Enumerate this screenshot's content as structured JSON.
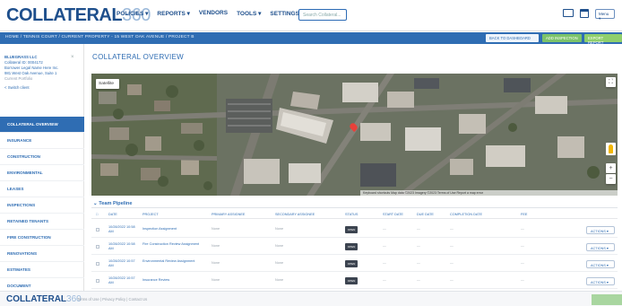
{
  "app": {
    "logo_bold": "COLLATERAL",
    "logo_light": "360"
  },
  "nav": [
    {
      "label": "POLICIES ▾"
    },
    {
      "label": "REPORTS ▾"
    },
    {
      "label": "VENDORS"
    },
    {
      "label": "TOOLS ▾"
    },
    {
      "label": "SETTINGS ▾"
    }
  ],
  "search": {
    "placeholder": "Search Collateral..."
  },
  "user": {
    "label": "Menu ▾"
  },
  "breadcrumb": "HOME / TENNIS COURT / CURRENT PROPERTY - 15 WEST OAK AVENUE / PROJECT B",
  "crumb_buttons": {
    "back": "BACK TO DASHBOARD",
    "add": "ADD INSPECTION",
    "export": "EXPORT REPORT"
  },
  "client": {
    "name": "BLUEGRASS LLC",
    "id": "Collateral ID: 0004172",
    "line1": "Borrower Legal Name Here Inc.",
    "line2": "981 West Oak Avenue, Suite 1",
    "status": "Current Portfolio",
    "action": "< Switch client",
    "close": "×"
  },
  "sidebar": {
    "items": [
      {
        "label": "COLLATERAL OVERVIEW",
        "active": true
      },
      {
        "label": "INSURANCE",
        "active": false
      },
      {
        "label": "CONSTRUCTION",
        "active": false
      },
      {
        "label": "ENVIRONMENTAL",
        "active": false
      },
      {
        "label": "LEASES",
        "active": false
      },
      {
        "label": "INSPECTIONS",
        "active": false
      },
      {
        "label": "RETAINED TENANTS",
        "active": false
      },
      {
        "label": "FIRE CONSTRUCTION",
        "active": false
      },
      {
        "label": "RENOVATIONS",
        "active": false
      },
      {
        "label": "ESTIMATES",
        "active": false
      },
      {
        "label": "DOCUMENT",
        "active": false
      }
    ]
  },
  "page": {
    "title": "COLLATERAL OVERVIEW"
  },
  "map": {
    "view_button": "Satellite",
    "footer": "Keyboard shortcuts  Map data ©2023 Imagery ©2023  Terms of Use  Report a map error",
    "marker_color": "#e8403a",
    "zoom_in": "+",
    "zoom_out": "−"
  },
  "pipeline": {
    "title": "Team Pipeline",
    "columns": [
      "DATE",
      "PROJECT",
      "PRIMARY ASSIGNEE",
      "SECONDARY ASSIGNEE",
      "STATUS",
      "START DATE",
      "DUE DATE",
      "COMPLETION DATE",
      "FEE"
    ],
    "rows": [
      {
        "date": "10/28/2022 10:58 AM",
        "project": "Inspection Assignment",
        "primary": "None",
        "secondary": "None",
        "status": "OPEN",
        "start": "—",
        "due": "—",
        "completion": "—",
        "fee": "—",
        "action": "ACTIONS ▾"
      },
      {
        "date": "10/28/2022 10:58 AM",
        "project": "Fire Construction Review Assignment",
        "primary": "None",
        "secondary": "None",
        "status": "OPEN",
        "start": "—",
        "due": "—",
        "completion": "—",
        "fee": "—",
        "action": "ACTIONS ▾"
      },
      {
        "date": "10/28/2022 10:57 AM",
        "project": "Environmental Review Assignment",
        "primary": "None",
        "secondary": "None",
        "status": "OPEN",
        "start": "—",
        "due": "—",
        "completion": "—",
        "fee": "—",
        "action": "ACTIONS ▾"
      },
      {
        "date": "10/28/2022 10:57 AM",
        "project": "Insurance Review",
        "primary": "None",
        "secondary": "None",
        "status": "OPEN",
        "start": "—",
        "due": "—",
        "completion": "—",
        "fee": "—",
        "action": "ACTIONS ▾"
      }
    ]
  },
  "footer": {
    "logo_bold": "COLLATERAL",
    "logo_light": "360",
    "links": "Terms of Use  |  Privacy Policy  |  Contact Us"
  },
  "colors": {
    "brand": "#1e4f8c",
    "accent": "#2f6db3",
    "success": "#7cc36a",
    "status_badge": "#3c4450"
  }
}
